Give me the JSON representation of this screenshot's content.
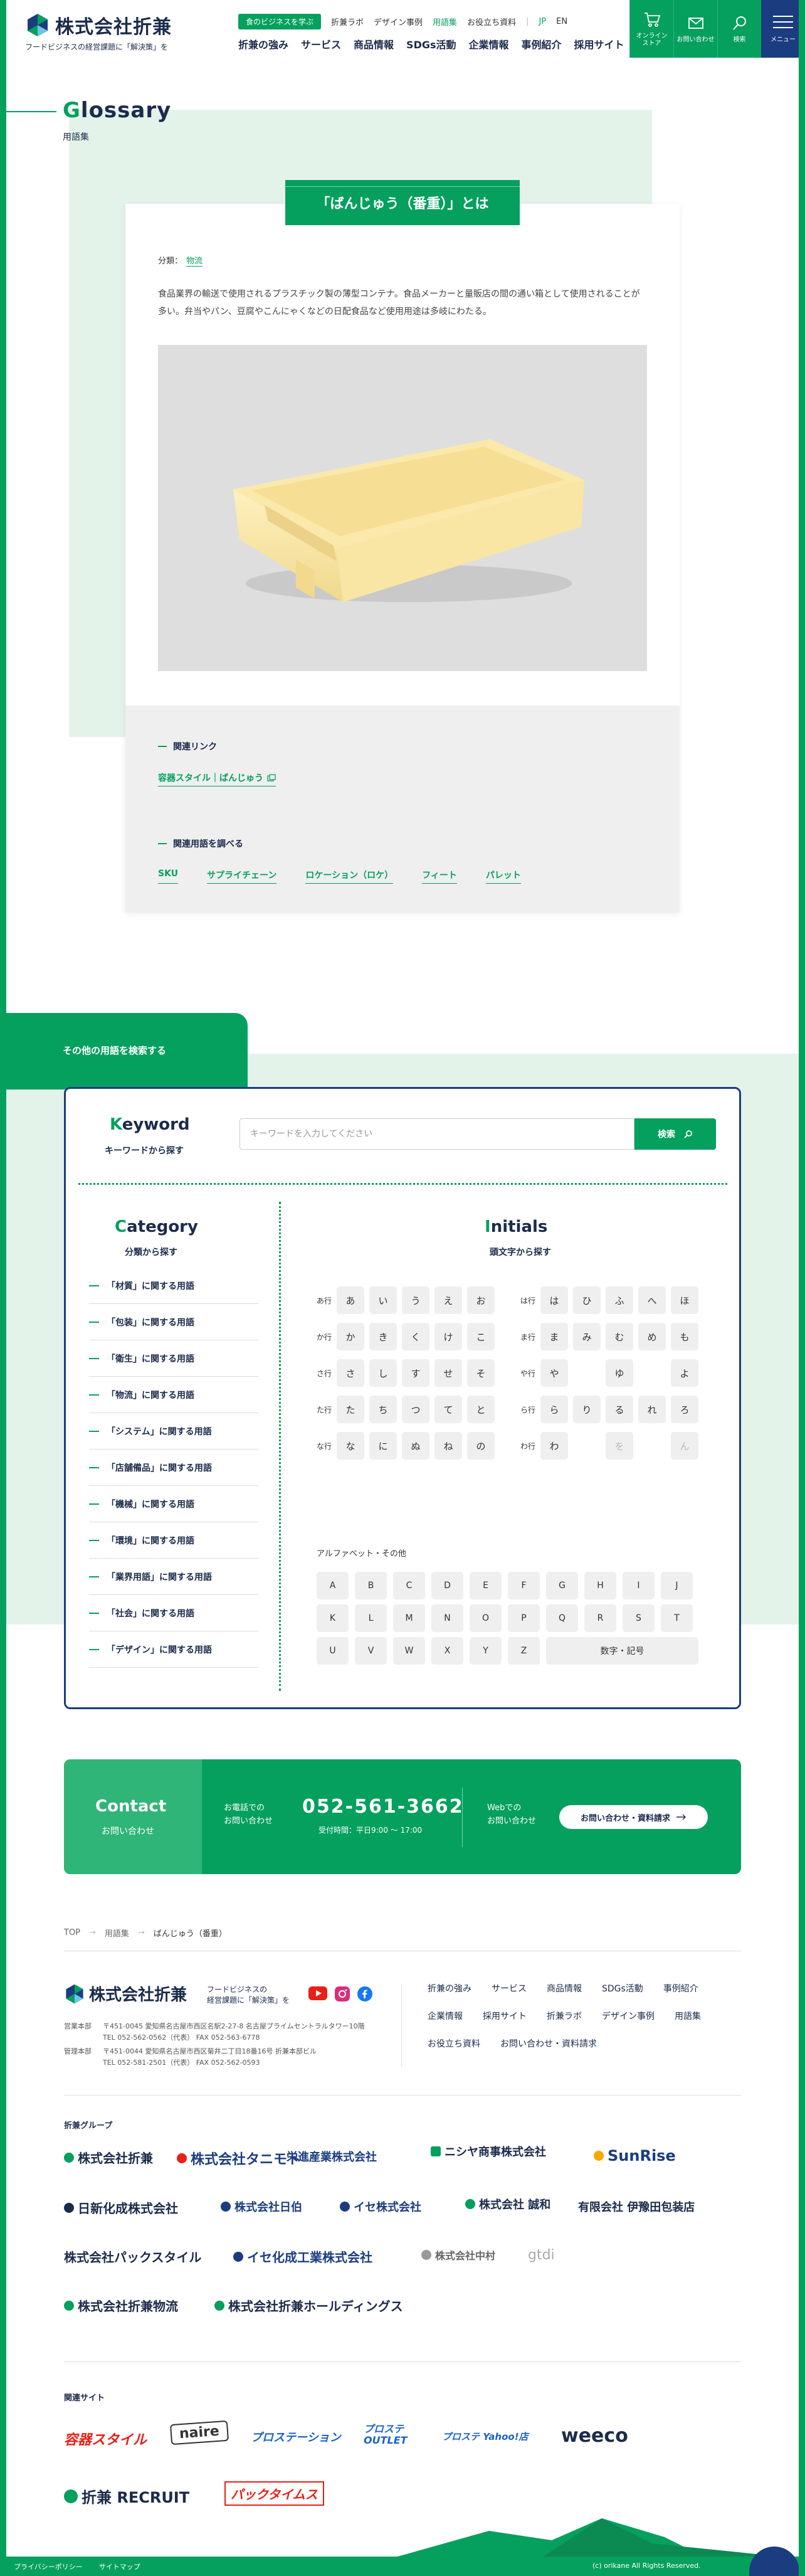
{
  "header": {
    "logo_text": "株式会社折兼",
    "logo_sub": "フードビジネスの経営課題に「解決策」を",
    "pill": "食のビジネスを学ぶ",
    "top_links": [
      "折兼ラボ",
      "デザイン事例",
      "用語集",
      "お役立ち資料"
    ],
    "lang_jp": "JP",
    "lang_en": "EN",
    "main_nav": [
      "折兼の強み",
      "サービス",
      "商品情報",
      "SDGs活動",
      "企業情報",
      "事例紹介",
      "採用サイト"
    ],
    "icons": {
      "store": "オンライン\nストア",
      "contact": "お問い合わせ",
      "search": "検索"
    },
    "menu": "メニュー"
  },
  "glossary": {
    "title_first": "G",
    "title_rest": "lossary",
    "sub": "用語集"
  },
  "term": {
    "title": "「ばんじゅう（番重）」とは",
    "category_label": "分類：",
    "category": "物流",
    "description": "食品業界の輸送で使用されるプラスチック製の薄型コンテナ。食品メーカーと量販店の間の通い箱として使用されることが多い。弁当やパン、豆腐やこんにゃくなどの日配食品など使用用途は多岐にわたる。",
    "links_heading": "関連リンク",
    "link": "容器スタイル｜ばんじゅう",
    "related_heading": "関連用語を調べる",
    "related": [
      "SKU",
      "サプライチェーン",
      "ロケーション（ロケ）",
      "フィート",
      "パレット"
    ]
  },
  "search": {
    "tab": "その他の用語を検索する",
    "kw_first": "K",
    "kw_rest": "eyword",
    "kw_sub": "キーワードから探す",
    "placeholder": "キーワードを入力してください",
    "button": "検索",
    "cat_first": "C",
    "cat_rest": "ategory",
    "cat_sub": "分類から探す",
    "categories": [
      "「材質」に関する用語",
      "「包装」に関する用語",
      "「衛生」に関する用語",
      "「物流」に関する用語",
      "「システム」に関する用語",
      "「店舗備品」に関する用語",
      "「機械」に関する用語",
      "「環境」に関する用語",
      "「業界用語」に関する用語",
      "「社会」に関する用語",
      "「デザイン」に関する用語"
    ],
    "ini_first": "I",
    "ini_rest": "nitials",
    "ini_sub": "頭文字から探す",
    "kana_left": [
      {
        "label": "あ行",
        "chars": [
          "あ",
          "い",
          "う",
          "え",
          "お"
        ]
      },
      {
        "label": "か行",
        "chars": [
          "か",
          "き",
          "く",
          "け",
          "こ"
        ]
      },
      {
        "label": "さ行",
        "chars": [
          "さ",
          "し",
          "す",
          "せ",
          "そ"
        ]
      },
      {
        "label": "た行",
        "chars": [
          "た",
          "ち",
          "つ",
          "て",
          "と"
        ]
      },
      {
        "label": "な行",
        "chars": [
          "な",
          "に",
          "ぬ",
          "ね",
          "の"
        ]
      }
    ],
    "kana_right": [
      {
        "label": "は行",
        "chars": [
          "は",
          "ひ",
          "ふ",
          "へ",
          "ほ"
        ]
      },
      {
        "label": "ま行",
        "chars": [
          "ま",
          "み",
          "む",
          "め",
          "も"
        ]
      },
      {
        "label": "や行",
        "chars": [
          "や",
          "",
          "ゆ",
          "",
          "よ"
        ]
      },
      {
        "label": "ら行",
        "chars": [
          "ら",
          "り",
          "る",
          "れ",
          "ろ"
        ]
      },
      {
        "label": "わ行",
        "chars": [
          "わ",
          "",
          "を",
          "",
          "ん"
        ]
      }
    ],
    "alpha_label": "アルファベット・その他",
    "alphabet": [
      "A",
      "B",
      "C",
      "D",
      "E",
      "F",
      "G",
      "H",
      "I",
      "J",
      "K",
      "L",
      "M",
      "N",
      "O",
      "P",
      "Q",
      "R",
      "S",
      "T",
      "U",
      "V",
      "W",
      "X",
      "Y",
      "Z"
    ],
    "other": "数字・記号"
  },
  "contact": {
    "heading": "Contact",
    "sub": "お問い合わせ",
    "tel_label_1": "お電話での",
    "tel_label_2": "お問い合わせ",
    "tel": "052-561-3662",
    "hours": "受付時間：平日9:00 〜 17:00",
    "web_label_1": "Webでの",
    "web_label_2": "お問い合わせ",
    "web_btn": "お問い合わせ・資料請求"
  },
  "breadcrumb": [
    "TOP",
    "用語集",
    "ばんじゅう（番重）"
  ],
  "footer": {
    "logo_text": "株式会社折兼",
    "logo_sub_1": "フードビジネスの",
    "logo_sub_2": "経営課題に「解決策」を",
    "addr1_label": "営業本部",
    "addr1_1": "〒451-0045 愛知県名古屋市西区名駅2-27-8 名古屋プライムセントラルタワー10階",
    "addr1_2": "TEL 052-562-0562（代表） FAX 052-563-6778",
    "addr2_label": "管理本部",
    "addr2_1": "〒451-0044 愛知県名古屋市西区菊井二丁目18番16号 折兼本部ビル",
    "addr2_2": "TEL 052-581-2501（代表） FAX 052-562-0593",
    "nav": [
      "折兼の強み",
      "サービス",
      "商品情報",
      "SDGs活動",
      "事例紹介",
      "企業情報",
      "採用サイト",
      "折兼ラボ",
      "デザイン事例",
      "用語集",
      "お役立ち資料",
      "お問い合わせ・資料請求"
    ],
    "group_heading": "折兼グループ",
    "group": [
      "株式会社折兼",
      "株式会社タニモト",
      "栄進産業株式会社",
      "ニシヤ商事株式会社",
      "SunRise",
      "日新化成株式会社",
      "株式会社日伯",
      "イセ株式会社",
      "株式会社 誠和",
      "有限会社 伊豫田包装店",
      "株式会社パックスタイル",
      "イセ化成工業株式会社",
      "株式会社中村",
      "gtdi",
      "株式会社折兼物流",
      "株式会社折兼ホールディングス"
    ],
    "related_heading": "関連サイト",
    "related": [
      "容器スタイル",
      "naire",
      "プロステーション",
      "プロステ OUTLET",
      "プロステ Yahoo!店",
      "weeco",
      "折兼 RECRUIT",
      "パックタイムス"
    ],
    "privacy": "プライバシーポリシー",
    "sitemap": "サイトマップ",
    "copyright": "(c) orikane All Rights Reserved."
  },
  "colors": {
    "green": "#05a05e",
    "navy": "#1b3d80",
    "light_green": "#e4f3ea"
  }
}
